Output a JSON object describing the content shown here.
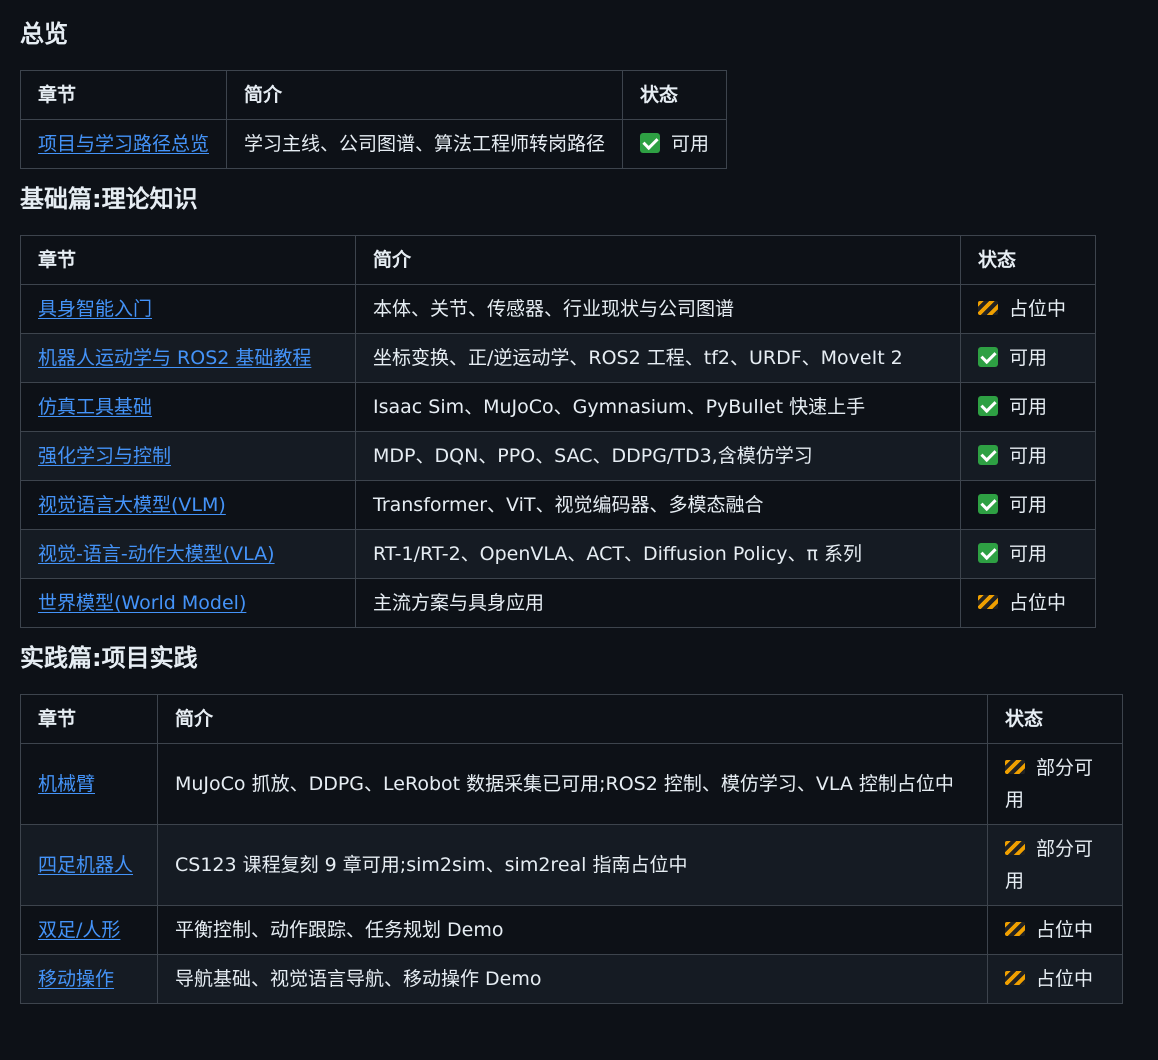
{
  "sections": [
    {
      "title": "总览",
      "headers": [
        "章节",
        "简介",
        "状态"
      ],
      "rows": [
        {
          "chapter": "项目与学习路径总览",
          "desc": "学习主线、公司图谱、算法工程师转岗路径",
          "status": "可用",
          "icon": "check"
        }
      ]
    },
    {
      "title": "基础篇:理论知识",
      "headers": [
        "章节",
        "简介",
        "状态"
      ],
      "rows": [
        {
          "chapter": "具身智能入门",
          "desc": "本体、关节、传感器、行业现状与公司图谱",
          "status": "占位中",
          "icon": "construction"
        },
        {
          "chapter": "机器人运动学与 ROS2 基础教程",
          "desc": "坐标变换、正/逆运动学、ROS2 工程、tf2、URDF、MoveIt 2",
          "status": "可用",
          "icon": "check"
        },
        {
          "chapter": "仿真工具基础",
          "desc": "Isaac Sim、MuJoCo、Gymnasium、PyBullet 快速上手",
          "status": "可用",
          "icon": "check"
        },
        {
          "chapter": "强化学习与控制",
          "desc": "MDP、DQN、PPO、SAC、DDPG/TD3,含模仿学习",
          "status": "可用",
          "icon": "check"
        },
        {
          "chapter": "视觉语言大模型(VLM)",
          "desc": "Transformer、ViT、视觉编码器、多模态融合",
          "status": "可用",
          "icon": "check"
        },
        {
          "chapter": "视觉-语言-动作大模型(VLA)",
          "desc": "RT-1/RT-2、OpenVLA、ACT、Diffusion Policy、π 系列",
          "status": "可用",
          "icon": "check"
        },
        {
          "chapter": "世界模型(World Model)",
          "desc": "主流方案与具身应用",
          "status": "占位中",
          "icon": "construction"
        }
      ]
    },
    {
      "title": "实践篇:项目实践",
      "headers": [
        "章节",
        "简介",
        "状态"
      ],
      "rows": [
        {
          "chapter": "机械臂",
          "desc": "MuJoCo 抓放、DDPG、LeRobot 数据采集已可用;ROS2 控制、模仿学习、VLA 控制占位中",
          "status": "部分可用",
          "icon": "construction"
        },
        {
          "chapter": "四足机器人",
          "desc": "CS123 课程复刻 9 章可用;sim2sim、sim2real 指南占位中",
          "status": "部分可用",
          "icon": "construction"
        },
        {
          "chapter": "双足/人形",
          "desc": "平衡控制、动作跟踪、任务规划 Demo",
          "status": "占位中",
          "icon": "construction"
        },
        {
          "chapter": "移动操作",
          "desc": "导航基础、视觉语言导航、移动操作 Demo",
          "status": "占位中",
          "icon": "construction"
        }
      ]
    }
  ]
}
